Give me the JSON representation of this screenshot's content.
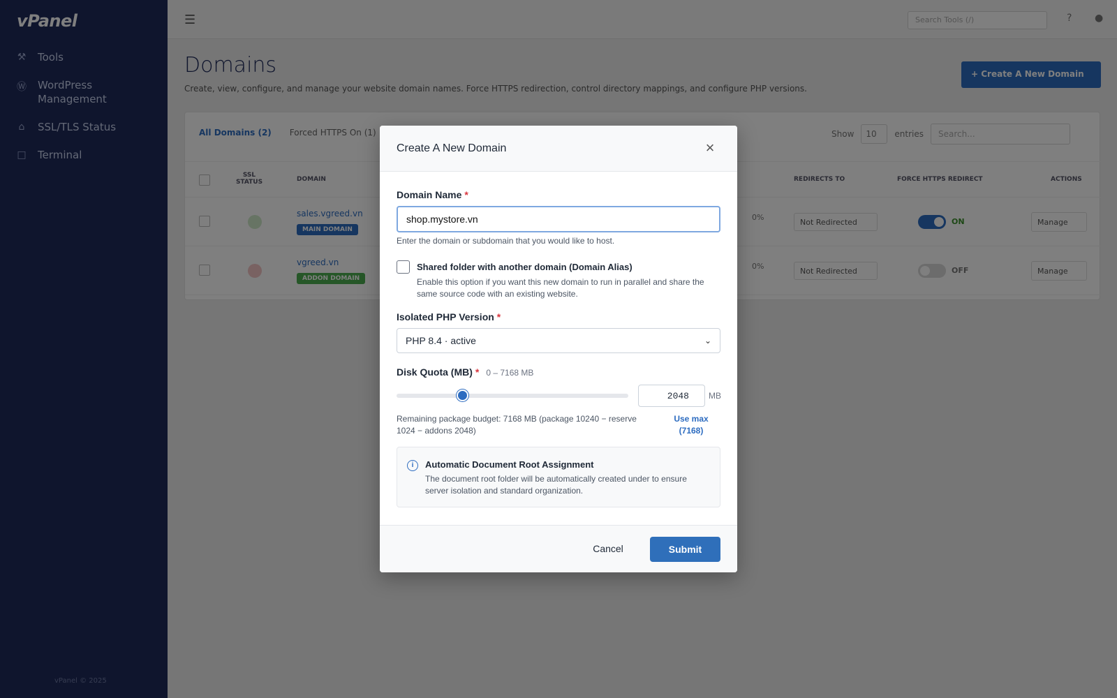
{
  "sidebar": {
    "logo": "vPanel",
    "items": [
      {
        "label": "Tools",
        "icon": "wrench-icon"
      },
      {
        "label": "WordPress Management",
        "icon": "wordpress-icon"
      },
      {
        "label": "SSL/TLS Status",
        "icon": "lock-icon"
      },
      {
        "label": "Terminal",
        "icon": "terminal-icon"
      }
    ],
    "footer": "vPanel © 2025"
  },
  "topbar": {
    "search_placeholder": "Search Tools (/)"
  },
  "page": {
    "title": "Domains",
    "description": "Create, view, configure, and manage your website domain names. Force HTTPS redirection, control directory mappings, and configure PHP versions.",
    "create_button": "+ Create A New Domain"
  },
  "card": {
    "tabs": [
      "All Domains (2)",
      "Forced HTTPS On (1)"
    ],
    "show_label": "Show",
    "show_value": "10",
    "show_suffix": "entries",
    "search_placeholder": "Search...",
    "columns": [
      "SSL Status",
      "Domain",
      "Redirects To",
      "Force HTTPS Redirect",
      "Actions"
    ],
    "rows": [
      {
        "domain": "sales.vgreed.vn",
        "badge": "MAIN DOMAIN",
        "count": "0%",
        "redirect": "Not Redirected",
        "toggle": "ON",
        "action": "Manage"
      },
      {
        "domain": "vgreed.vn",
        "badge": "ADDON DOMAIN",
        "count": "0%",
        "redirect": "Not Redirected",
        "toggle": "OFF",
        "action": "Manage"
      }
    ]
  },
  "modal": {
    "title": "Create A New Domain",
    "close": "×",
    "domain_label": "Domain Name",
    "required_mark": "*",
    "domain_value": "shop.mystore.vn",
    "domain_hint": "Enter the domain or subdomain that you would like to host.",
    "alias_label": "Shared folder with another domain (Domain Alias)",
    "alias_desc": "Enable this option if you want this new domain to run in parallel and share the same source code with an existing website.",
    "php_label": "Isolated PHP Version",
    "php_value": "PHP 8.4 · active",
    "quota_label": "Disk Quota (MB)",
    "quota_range": "0 – 7168 MB",
    "quota_value": "2048",
    "quota_max": 7168,
    "quota_unit": "MB",
    "budget_text": "Remaining package budget: 7168 MB (package 10240 − reserve 1024 − addons 2048)",
    "use_max": "Use max (7168)",
    "info_title": "Automatic Document Root Assignment",
    "info_text": "The document root folder will be automatically created under to ensure server isolation and standard organization.",
    "cancel": "Cancel",
    "submit": "Submit"
  },
  "colors": {
    "sidebar": "#1e2a5a",
    "accent": "#2d6cc0",
    "required": "#d9363e"
  }
}
